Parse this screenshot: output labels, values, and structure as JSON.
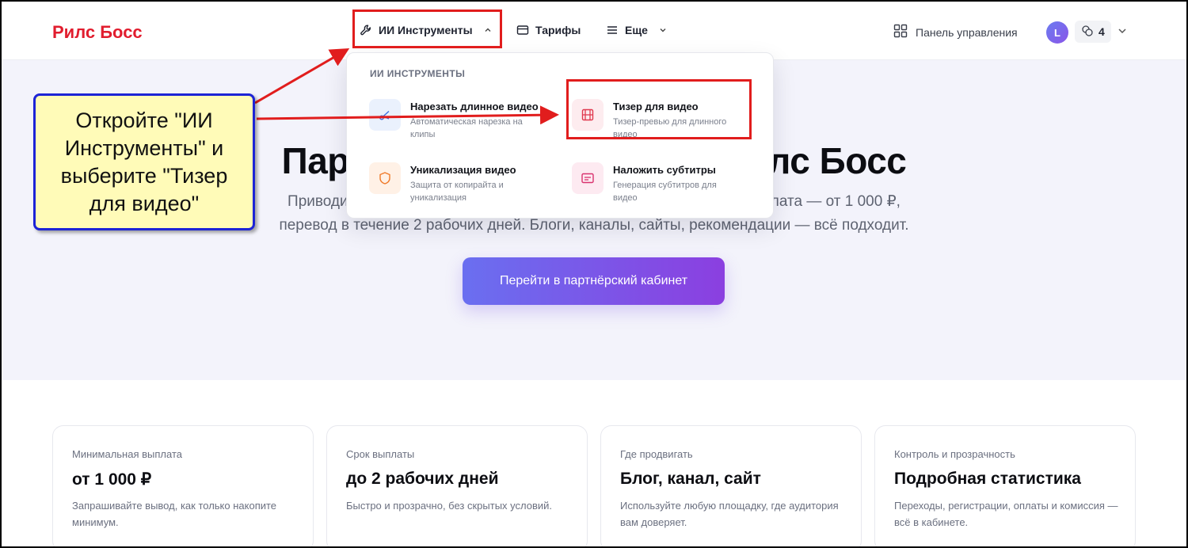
{
  "header": {
    "logo": "Рилс Босс",
    "nav": {
      "tools_label": "ИИ Инструменты",
      "tariffs_label": "Тарифы",
      "more_label": "Еще"
    },
    "dashboard_label": "Панель управления",
    "user_initial": "L",
    "coins": "4"
  },
  "dropdown": {
    "heading": "ИИ ИНСТРУМЕНТЫ",
    "items": [
      {
        "title": "Нарезать длинное видео",
        "desc": "Автоматическая нарезка на клипы",
        "icon": "scissors-icon"
      },
      {
        "title": "Тизер для видео",
        "desc": "Тизер-превью для длинного видео",
        "icon": "film-icon"
      },
      {
        "title": "Уникализация видео",
        "desc": "Защита от копирайта и уникализация",
        "icon": "shield-icon"
      },
      {
        "title": "Наложить субтитры",
        "desc": "Генерация субтитров для видео",
        "icon": "subtitles-icon"
      }
    ]
  },
  "hero": {
    "title": "Партнёрская программа Рилс Босс",
    "subtitle": "Приводите пользователей и получайте комиссию. Минимальная выплата — от 1 000 ₽, перевод в течение 2 рабочих дней. Блоги, каналы, сайты, рекомендации — всё подходит.",
    "cta": "Перейти в партнёрский кабинет"
  },
  "callout": {
    "text": "Откройте \"ИИ Инструменты\" и выберите \"Тизер для видео\""
  },
  "cards": [
    {
      "label": "Минимальная выплата",
      "value": "от 1 000 ₽",
      "desc": "Запрашивайте вывод, как только накопите минимум."
    },
    {
      "label": "Срок выплаты",
      "value": "до 2 рабочих дней",
      "desc": "Быстро и прозрачно, без скрытых условий."
    },
    {
      "label": "Где продвигать",
      "value": "Блог, канал, сайт",
      "desc": "Используйте любую площадку, где аудитория вам доверяет."
    },
    {
      "label": "Контроль и прозрачность",
      "value": "Подробная статистика",
      "desc": "Переходы, регистрации, оплаты и комиссия — всё в кабинете."
    }
  ],
  "colors": {
    "brand": "#e11d2e",
    "accent_start": "#6a6ff0",
    "accent_end": "#8b3fe0",
    "annotation_red": "#e11d1d",
    "callout_bg": "#fffbb8",
    "callout_border": "#1d24d6"
  }
}
